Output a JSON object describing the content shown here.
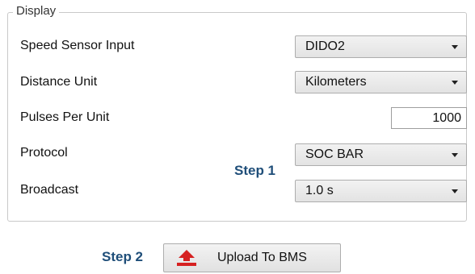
{
  "group": {
    "title": "Display"
  },
  "rows": [
    {
      "label": "Speed Sensor Input",
      "value": "DIDO2"
    },
    {
      "label": "Distance Unit",
      "value": "Kilometers"
    },
    {
      "label": "Pulses Per Unit",
      "value": "1000"
    },
    {
      "label": "Protocol",
      "value": "SOC BAR"
    },
    {
      "label": "Broadcast",
      "value": "1.0 s"
    }
  ],
  "steps": {
    "step1": "Step 1",
    "step2": "Step 2"
  },
  "upload_button": {
    "label": "Upload To BMS",
    "icon": "upload-icon",
    "icon_color": "#d62020"
  },
  "colors": {
    "step_text": "#1f4e79"
  }
}
